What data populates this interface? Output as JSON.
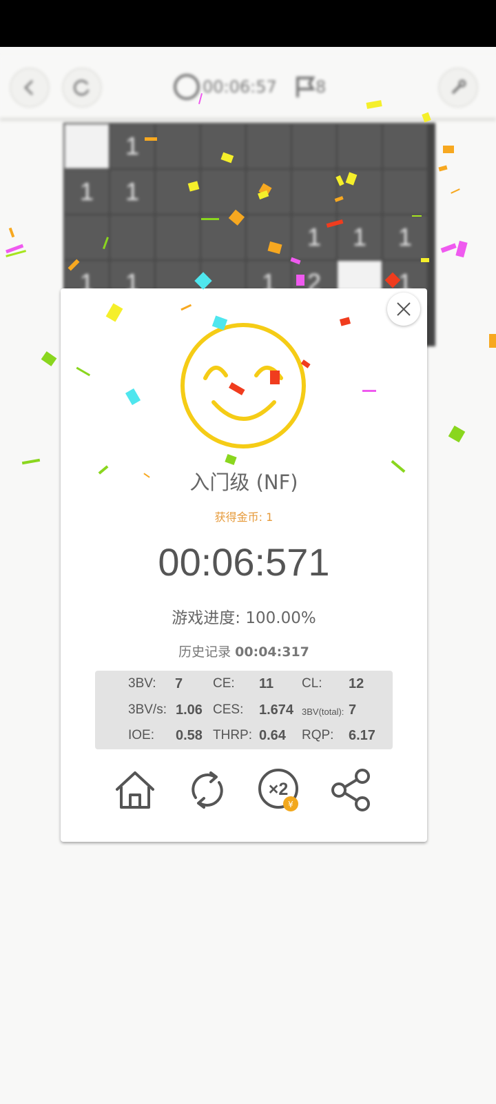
{
  "toolbar": {
    "back_icon": "chevron-left-icon",
    "restart_icon": "refresh-icon",
    "timer": "00:06:57",
    "flags": "8",
    "settings_icon": "tool-icon"
  },
  "board": {
    "columns": 8,
    "cells": [
      {
        "s": "open",
        "v": ""
      },
      {
        "s": "num",
        "v": "1"
      },
      {
        "s": "hidden",
        "v": ""
      },
      {
        "s": "hidden",
        "v": ""
      },
      {
        "s": "hidden",
        "v": ""
      },
      {
        "s": "hidden",
        "v": ""
      },
      {
        "s": "hidden",
        "v": ""
      },
      {
        "s": "hidden",
        "v": ""
      },
      {
        "s": "num",
        "v": "1"
      },
      {
        "s": "num",
        "v": "1"
      },
      {
        "s": "hidden",
        "v": ""
      },
      {
        "s": "hidden",
        "v": ""
      },
      {
        "s": "hidden",
        "v": ""
      },
      {
        "s": "hidden",
        "v": ""
      },
      {
        "s": "hidden",
        "v": ""
      },
      {
        "s": "hidden",
        "v": ""
      },
      {
        "s": "hidden",
        "v": ""
      },
      {
        "s": "hidden",
        "v": ""
      },
      {
        "s": "hidden",
        "v": ""
      },
      {
        "s": "hidden",
        "v": ""
      },
      {
        "s": "hidden",
        "v": ""
      },
      {
        "s": "num",
        "v": "1"
      },
      {
        "s": "num",
        "v": "1"
      },
      {
        "s": "num",
        "v": "1"
      },
      {
        "s": "num",
        "v": "1"
      },
      {
        "s": "num",
        "v": "1"
      },
      {
        "s": "hidden",
        "v": ""
      },
      {
        "s": "hidden",
        "v": ""
      },
      {
        "s": "num",
        "v": "1"
      },
      {
        "s": "num",
        "v": "2"
      },
      {
        "s": "open",
        "v": ""
      },
      {
        "s": "num",
        "v": "1"
      }
    ]
  },
  "dialog": {
    "close_icon": "close-icon",
    "face_icon": "happy-face-icon",
    "level": "入门级 (NF)",
    "coins": "获得金币: 1",
    "time": "00:06:571",
    "progress": "游戏进度: 100.00%",
    "record_label": "历史记录",
    "record_value": "00:04:317",
    "stats": {
      "bbbv_label": "3BV:",
      "bbbv": "7",
      "ce_label": "CE:",
      "ce": "11",
      "cl_label": "CL:",
      "cl": "12",
      "bbbvs_label": "3BV/s:",
      "bbbvs": "1.06",
      "ces_label": "CES:",
      "ces": "1.674",
      "bbbvt_label": "3BV(total):",
      "bbbvt": "7",
      "ioe_label": "IOE:",
      "ioe": "0.58",
      "thrp_label": "THRP:",
      "thrp": "0.64",
      "rqp_label": "RQP:",
      "rqp": "6.17"
    },
    "actions": {
      "home_icon": "home-icon",
      "replay_icon": "replay-icon",
      "double_icon": "double-coins-icon",
      "double_text": "×2",
      "coin_symbol": "¥",
      "share_icon": "share-icon"
    }
  },
  "colors": {
    "face": "#f5cc16",
    "coin_text": "#e69a3a",
    "coin_badge": "#f2a81d",
    "text_gray": "#555555"
  }
}
